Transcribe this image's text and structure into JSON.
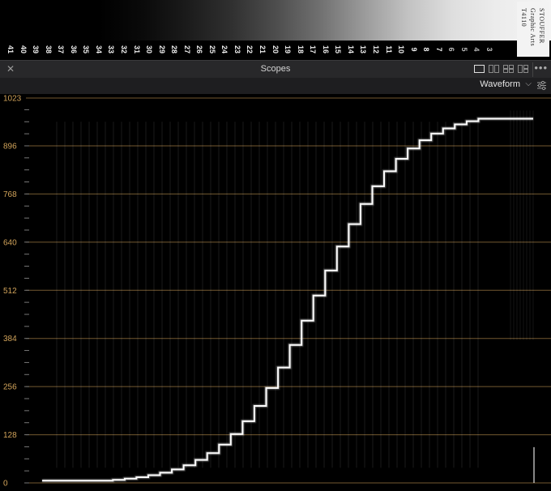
{
  "wedge": {
    "numbers": [
      "41",
      "40",
      "39",
      "38",
      "37",
      "36",
      "35",
      "34",
      "33",
      "32",
      "31",
      "30",
      "29",
      "28",
      "27",
      "26",
      "25",
      "24",
      "23",
      "22",
      "21",
      "20",
      "19",
      "18",
      "17",
      "16",
      "15",
      "14",
      "13",
      "12",
      "11",
      "10",
      "9",
      "8",
      "7",
      "6",
      "5",
      "4",
      "3"
    ],
    "maker_lines": [
      "STOUFFER",
      "Graphic Arts",
      "T4110"
    ]
  },
  "panel": {
    "title": "Scopes",
    "close_icon": "close-icon",
    "layout_icons": [
      "single-layout-icon",
      "dual-layout-icon",
      "quad-layout-icon",
      "grid-layout-icon"
    ],
    "more_icon": "more-options-icon"
  },
  "toolbar": {
    "scope_type": "Waveform",
    "settings_icon": "sliders-settings-icon"
  },
  "scope": {
    "graticule_color": "#d1a35a",
    "trace_color": "#ffffff",
    "levels": [
      "1023",
      "896",
      "768",
      "640",
      "512",
      "384",
      "256",
      "128",
      "0"
    ]
  }
}
